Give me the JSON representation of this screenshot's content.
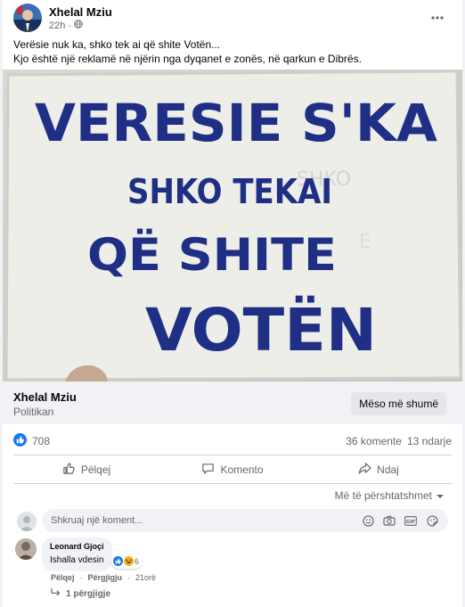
{
  "post": {
    "author": "Xhelal Mziu",
    "time": "22h",
    "privacy_icon": "globe-icon",
    "text_line1": "Verësie nuk ka, shko tek ai që shite Votën...",
    "text_line2": "Kjo është një reklamë në njërin nga dyqanet e zonës, në qarkun e Dibrës."
  },
  "photo": {
    "line1": "VERESIE S'KA",
    "line2": "SHKO TEKAI",
    "line3": "QË SHITE",
    "line4": "VOTËN",
    "ink_color": "#1f2f86",
    "paper_color": "#eeeee9"
  },
  "page_strip": {
    "name": "Xhelal Mziu",
    "category": "Politikan",
    "button": "Mëso më shumë"
  },
  "stats": {
    "reactions": "708",
    "comments": "36 komente",
    "shares": "13 ndarje"
  },
  "actions": {
    "like": "Pëlqej",
    "comment": "Komento",
    "share": "Ndaj"
  },
  "sort_label": "Më të përshtatshmet",
  "composer": {
    "placeholder": "Shkruaj një koment..."
  },
  "comment": {
    "author": "Leonard Gjoçi",
    "text": "Ishalla vdesin",
    "reaction_count": "6",
    "like": "Pëlqej",
    "reply": "Përgjigju",
    "time": "21orë",
    "replies": "1 përgjigje"
  },
  "colors": {
    "accent": "#1877f2",
    "secondary_text": "#65676b",
    "divider": "#ced0d4"
  }
}
